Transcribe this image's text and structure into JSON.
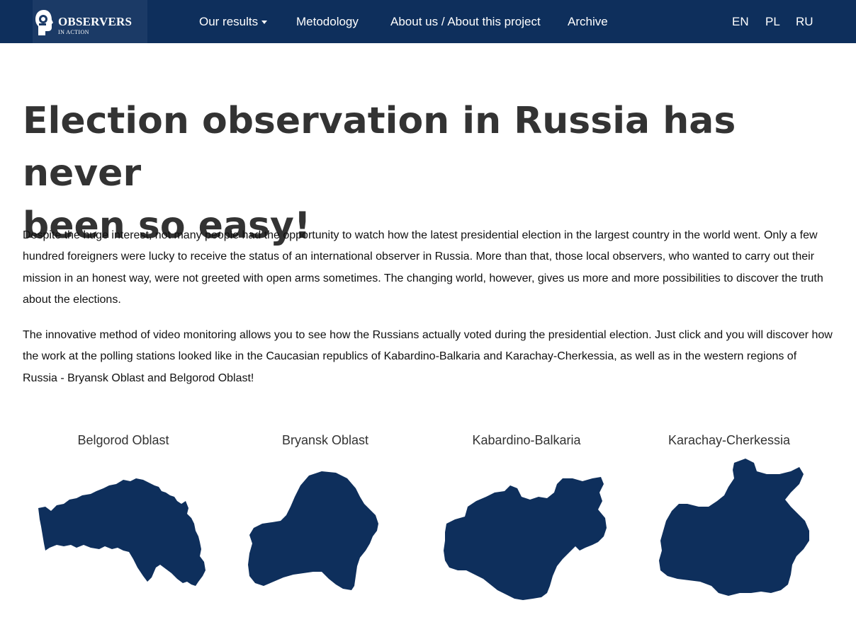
{
  "header": {
    "logo": {
      "title": "OBSERVERS",
      "subtitle": "IN ACTION"
    },
    "nav": [
      {
        "label": "Our results",
        "dropdown": true
      },
      {
        "label": "Metodology"
      },
      {
        "label": "About us / About this project"
      },
      {
        "label": "Archive"
      }
    ],
    "languages": [
      "EN",
      "PL",
      "RU"
    ]
  },
  "main": {
    "title_line1": "Election observation in Russia has never",
    "title_line2": "been so easy!",
    "paragraph1": "Despite the huge interest, not many people had the opportunity to watch how the latest presidential election in the largest country in the world went. Only a few hundred foreigners were lucky to receive the status of an international observer in Russia. More than that, those local observers, who wanted to carry out their mission in an honest way, were not greeted with open arms sometimes. The changing world, however, gives us more and more possibilities to discover the truth about the elections.",
    "paragraph2": "The innovative method of video monitoring allows you to see how the Russians actually voted during the presidential election. Just click and you will discover how the work at the polling stations looked like in the Caucasian republics of Kabardino-Balkaria and Karachay-Cherkessia, as well as in the western regions of Russia - Bryansk Oblast and Belgorod Oblast!"
  },
  "regions": [
    {
      "name": "Belgorod Oblast"
    },
    {
      "name": "Bryansk Oblast"
    },
    {
      "name": "Kabardino-Balkaria"
    },
    {
      "name": "Karachay-Cherkessia"
    }
  ],
  "colors": {
    "navbar": "#0e2f5c",
    "map_fill": "#0e2f5c",
    "heading": "#333333"
  }
}
